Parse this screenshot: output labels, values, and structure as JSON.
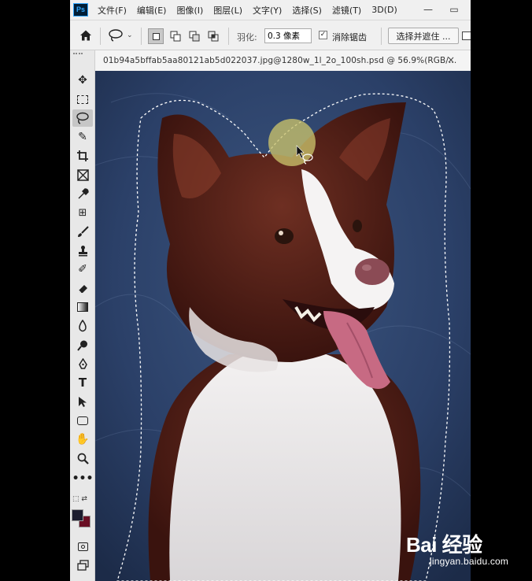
{
  "app": {
    "logo_text": "Ps",
    "menu": [
      "文件(F)",
      "编辑(E)",
      "图像(I)",
      "图层(L)",
      "文字(Y)",
      "选择(S)",
      "滤镜(T)",
      "3D(D)"
    ],
    "window_controls": {
      "minimize": "—",
      "restore": "▭"
    }
  },
  "options": {
    "feather_label": "羽化:",
    "feather_value": "0.3 像素",
    "antialias_label": "消除锯齿",
    "antialias_checked": true,
    "select_mask_label": "选择并遮住 ..."
  },
  "document": {
    "tab_title": "01b94a5bffab5aa80121ab5d022037.jpg@1280w_1l_2o_100sh.psd @ 56.9%(RGB/...",
    "close_glyph": "×"
  },
  "tools": [
    {
      "name": "move-tool",
      "icon": "move-icon"
    },
    {
      "name": "marquee-tool",
      "icon": "marquee-icon"
    },
    {
      "name": "lasso-tool",
      "icon": "lasso-icon",
      "active": true
    },
    {
      "name": "quick-select-tool",
      "icon": "quick-select-icon"
    },
    {
      "name": "crop-tool",
      "icon": "crop-icon"
    },
    {
      "name": "frame-tool",
      "icon": "frame-icon"
    },
    {
      "name": "eyedropper-tool",
      "icon": "eyedropper-icon"
    },
    {
      "name": "healing-brush-tool",
      "icon": "bandage-icon"
    },
    {
      "name": "brush-tool",
      "icon": "brush-icon"
    },
    {
      "name": "clone-stamp-tool",
      "icon": "stamp-icon"
    },
    {
      "name": "history-brush-tool",
      "icon": "history-brush-icon"
    },
    {
      "name": "eraser-tool",
      "icon": "eraser-icon"
    },
    {
      "name": "gradient-tool",
      "icon": "gradient-icon"
    },
    {
      "name": "blur-tool",
      "icon": "blur-icon"
    },
    {
      "name": "dodge-tool",
      "icon": "dodge-icon"
    },
    {
      "name": "pen-tool",
      "icon": "pen-icon"
    },
    {
      "name": "type-tool",
      "icon": "type-icon"
    },
    {
      "name": "path-select-tool",
      "icon": "arrow-icon"
    },
    {
      "name": "shape-tool",
      "icon": "rectangle-icon"
    },
    {
      "name": "hand-tool",
      "icon": "hand-icon"
    },
    {
      "name": "zoom-tool",
      "icon": "zoom-icon"
    },
    {
      "name": "more-tools",
      "icon": "ellipsis-icon"
    }
  ],
  "colors": {
    "foreground": "#1c1c2e",
    "background": "#6a0f24",
    "selection_cursor": "#c9c26a"
  },
  "watermark": {
    "brand": "Bai 经验",
    "url": "jingyan.baidu.com"
  }
}
